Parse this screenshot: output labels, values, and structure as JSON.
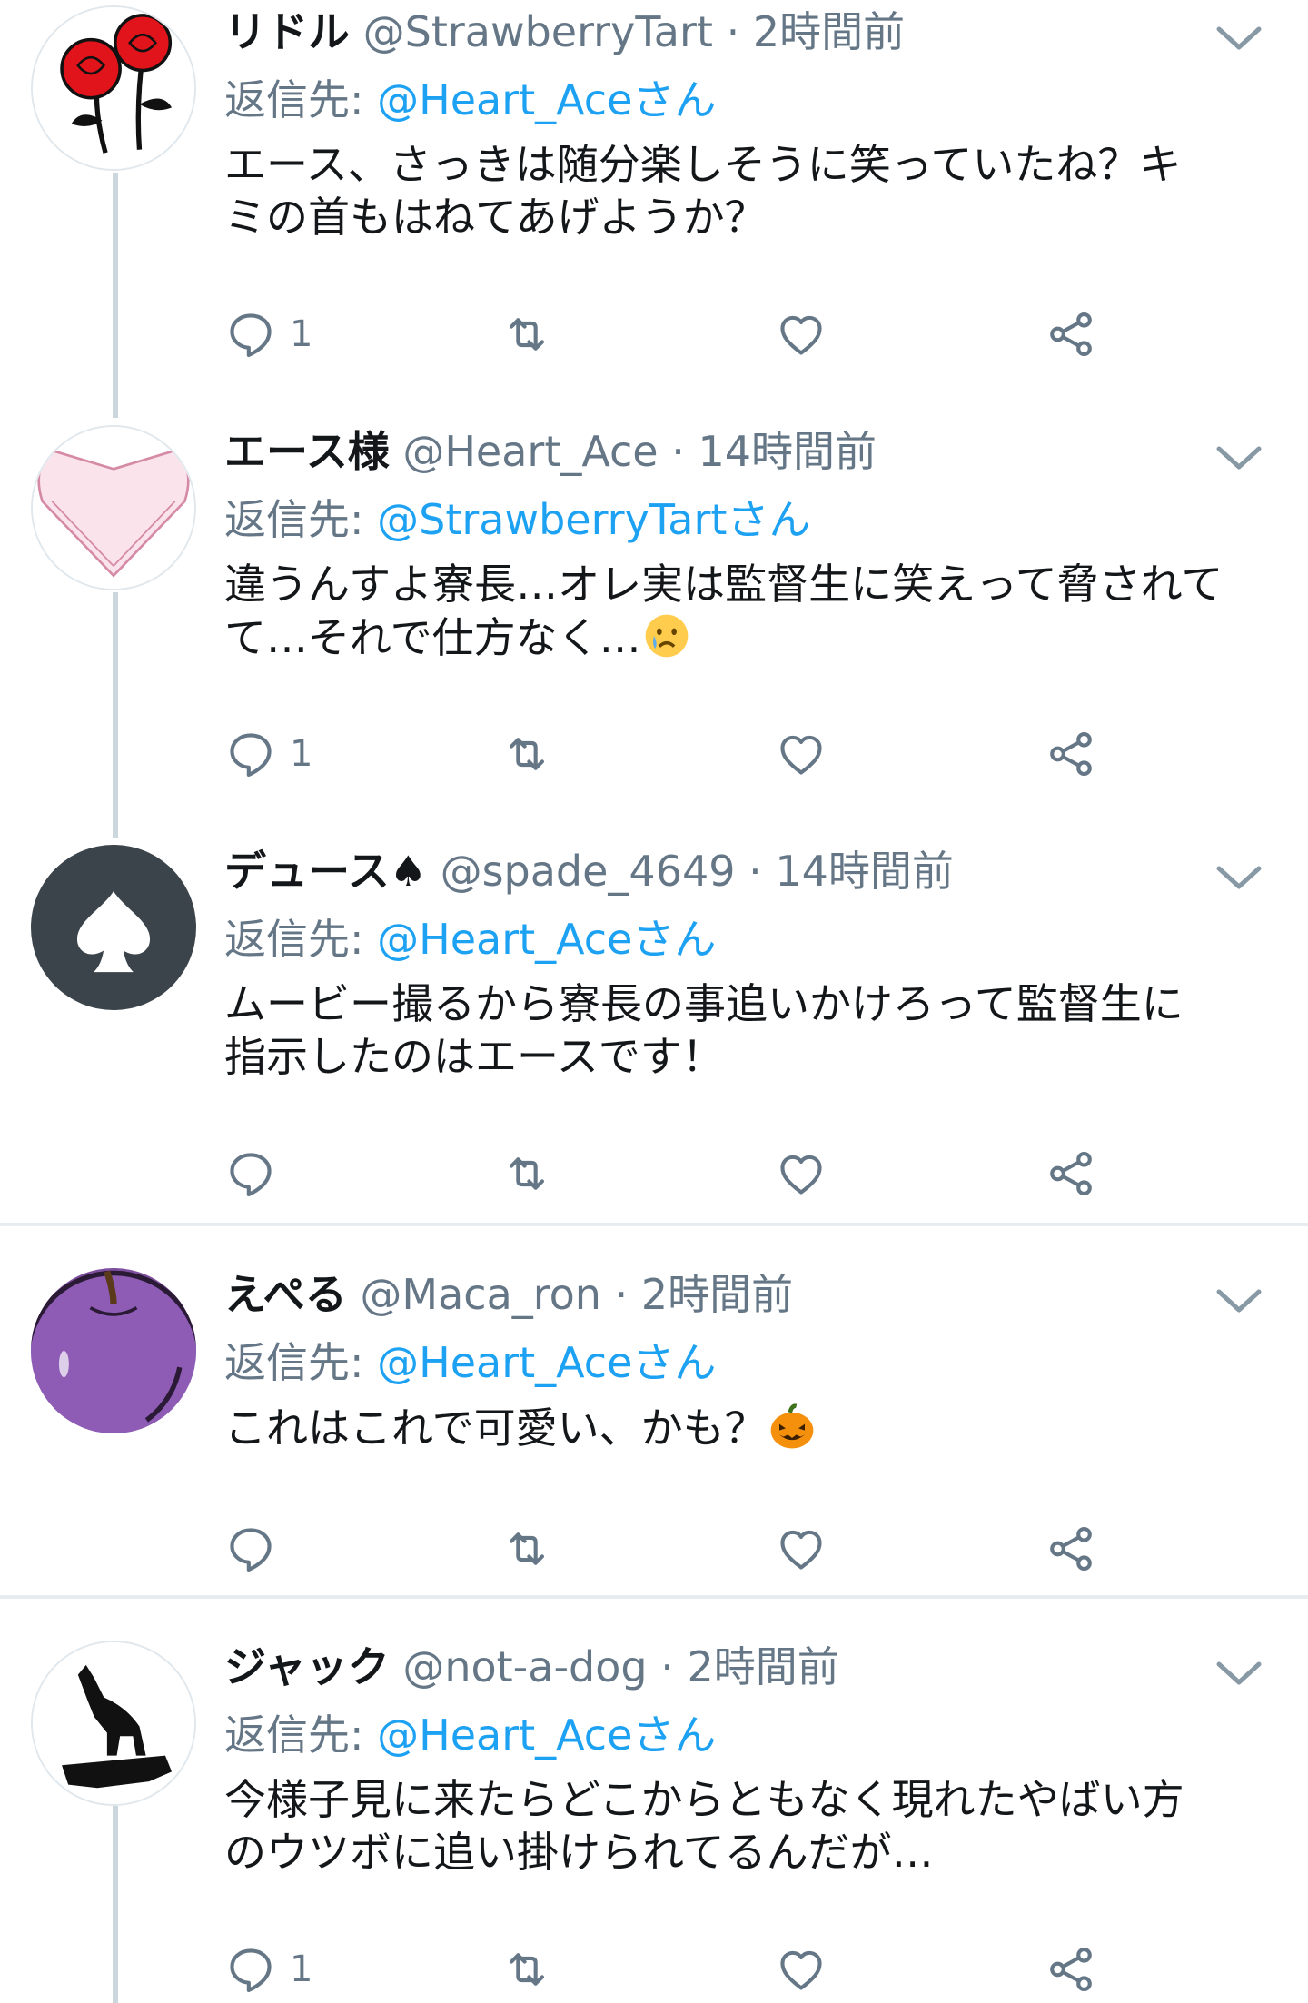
{
  "tweets": [
    {
      "name": "リドル",
      "handle": "@StrawberryTart",
      "separator": "·",
      "time": "2時間前",
      "reply_label": "返信先:",
      "reply_to": "@Heart_Aceさん",
      "text": "エース、さっきは随分楽しそうに笑っていたね？キ\nミの首もはねてあげようか？",
      "reply_count": "1",
      "avatar": "red-roses-avatar"
    },
    {
      "name": "エース様",
      "handle": "@Heart_Ace",
      "separator": "·",
      "time": "14時間前",
      "reply_label": "返信先:",
      "reply_to": "@StrawberryTartさん",
      "text": "違うんすよ寮長…オレ実は監督生に笑えって脅されて\nて…それで仕方なく…",
      "emoji": "crying-face-emoji",
      "reply_count": "1",
      "avatar": "pink-heart-avatar"
    },
    {
      "name": "デュース",
      "name_emoji": "♠",
      "handle": "@spade_4649",
      "separator": "·",
      "time": "14時間前",
      "reply_label": "返信先:",
      "reply_to": "@Heart_Aceさん",
      "text": "ムービー撮るから寮長の事追いかけろって監督生に\n指示したのはエースです！",
      "reply_count": "",
      "avatar": "spade-avatar"
    },
    {
      "name": "えぺる",
      "handle": "@Maca_ron",
      "separator": "·",
      "time": "2時間前",
      "reply_label": "返信先:",
      "reply_to": "@Heart_Aceさん",
      "text": "これはこれで可愛い、かも？",
      "emoji": "jack-o-lantern-emoji",
      "reply_count": "",
      "avatar": "purple-apple-avatar"
    },
    {
      "name": "ジャック",
      "handle": "@not-a-dog",
      "separator": "·",
      "time": "2時間前",
      "reply_label": "返信先:",
      "reply_to": "@Heart_Aceさん",
      "text": "今様子見に来たらどこからともなく現れたやばい方\nのウツボに追い掛けられてるんだが…",
      "reply_count": "1",
      "avatar": "howling-wolf-avatar"
    }
  ],
  "colors": {
    "link": "#1da1f2",
    "secondary_text": "#657786",
    "thread_line": "#ccd6dd",
    "divider": "#e6ecf0",
    "icon": "#657786"
  }
}
